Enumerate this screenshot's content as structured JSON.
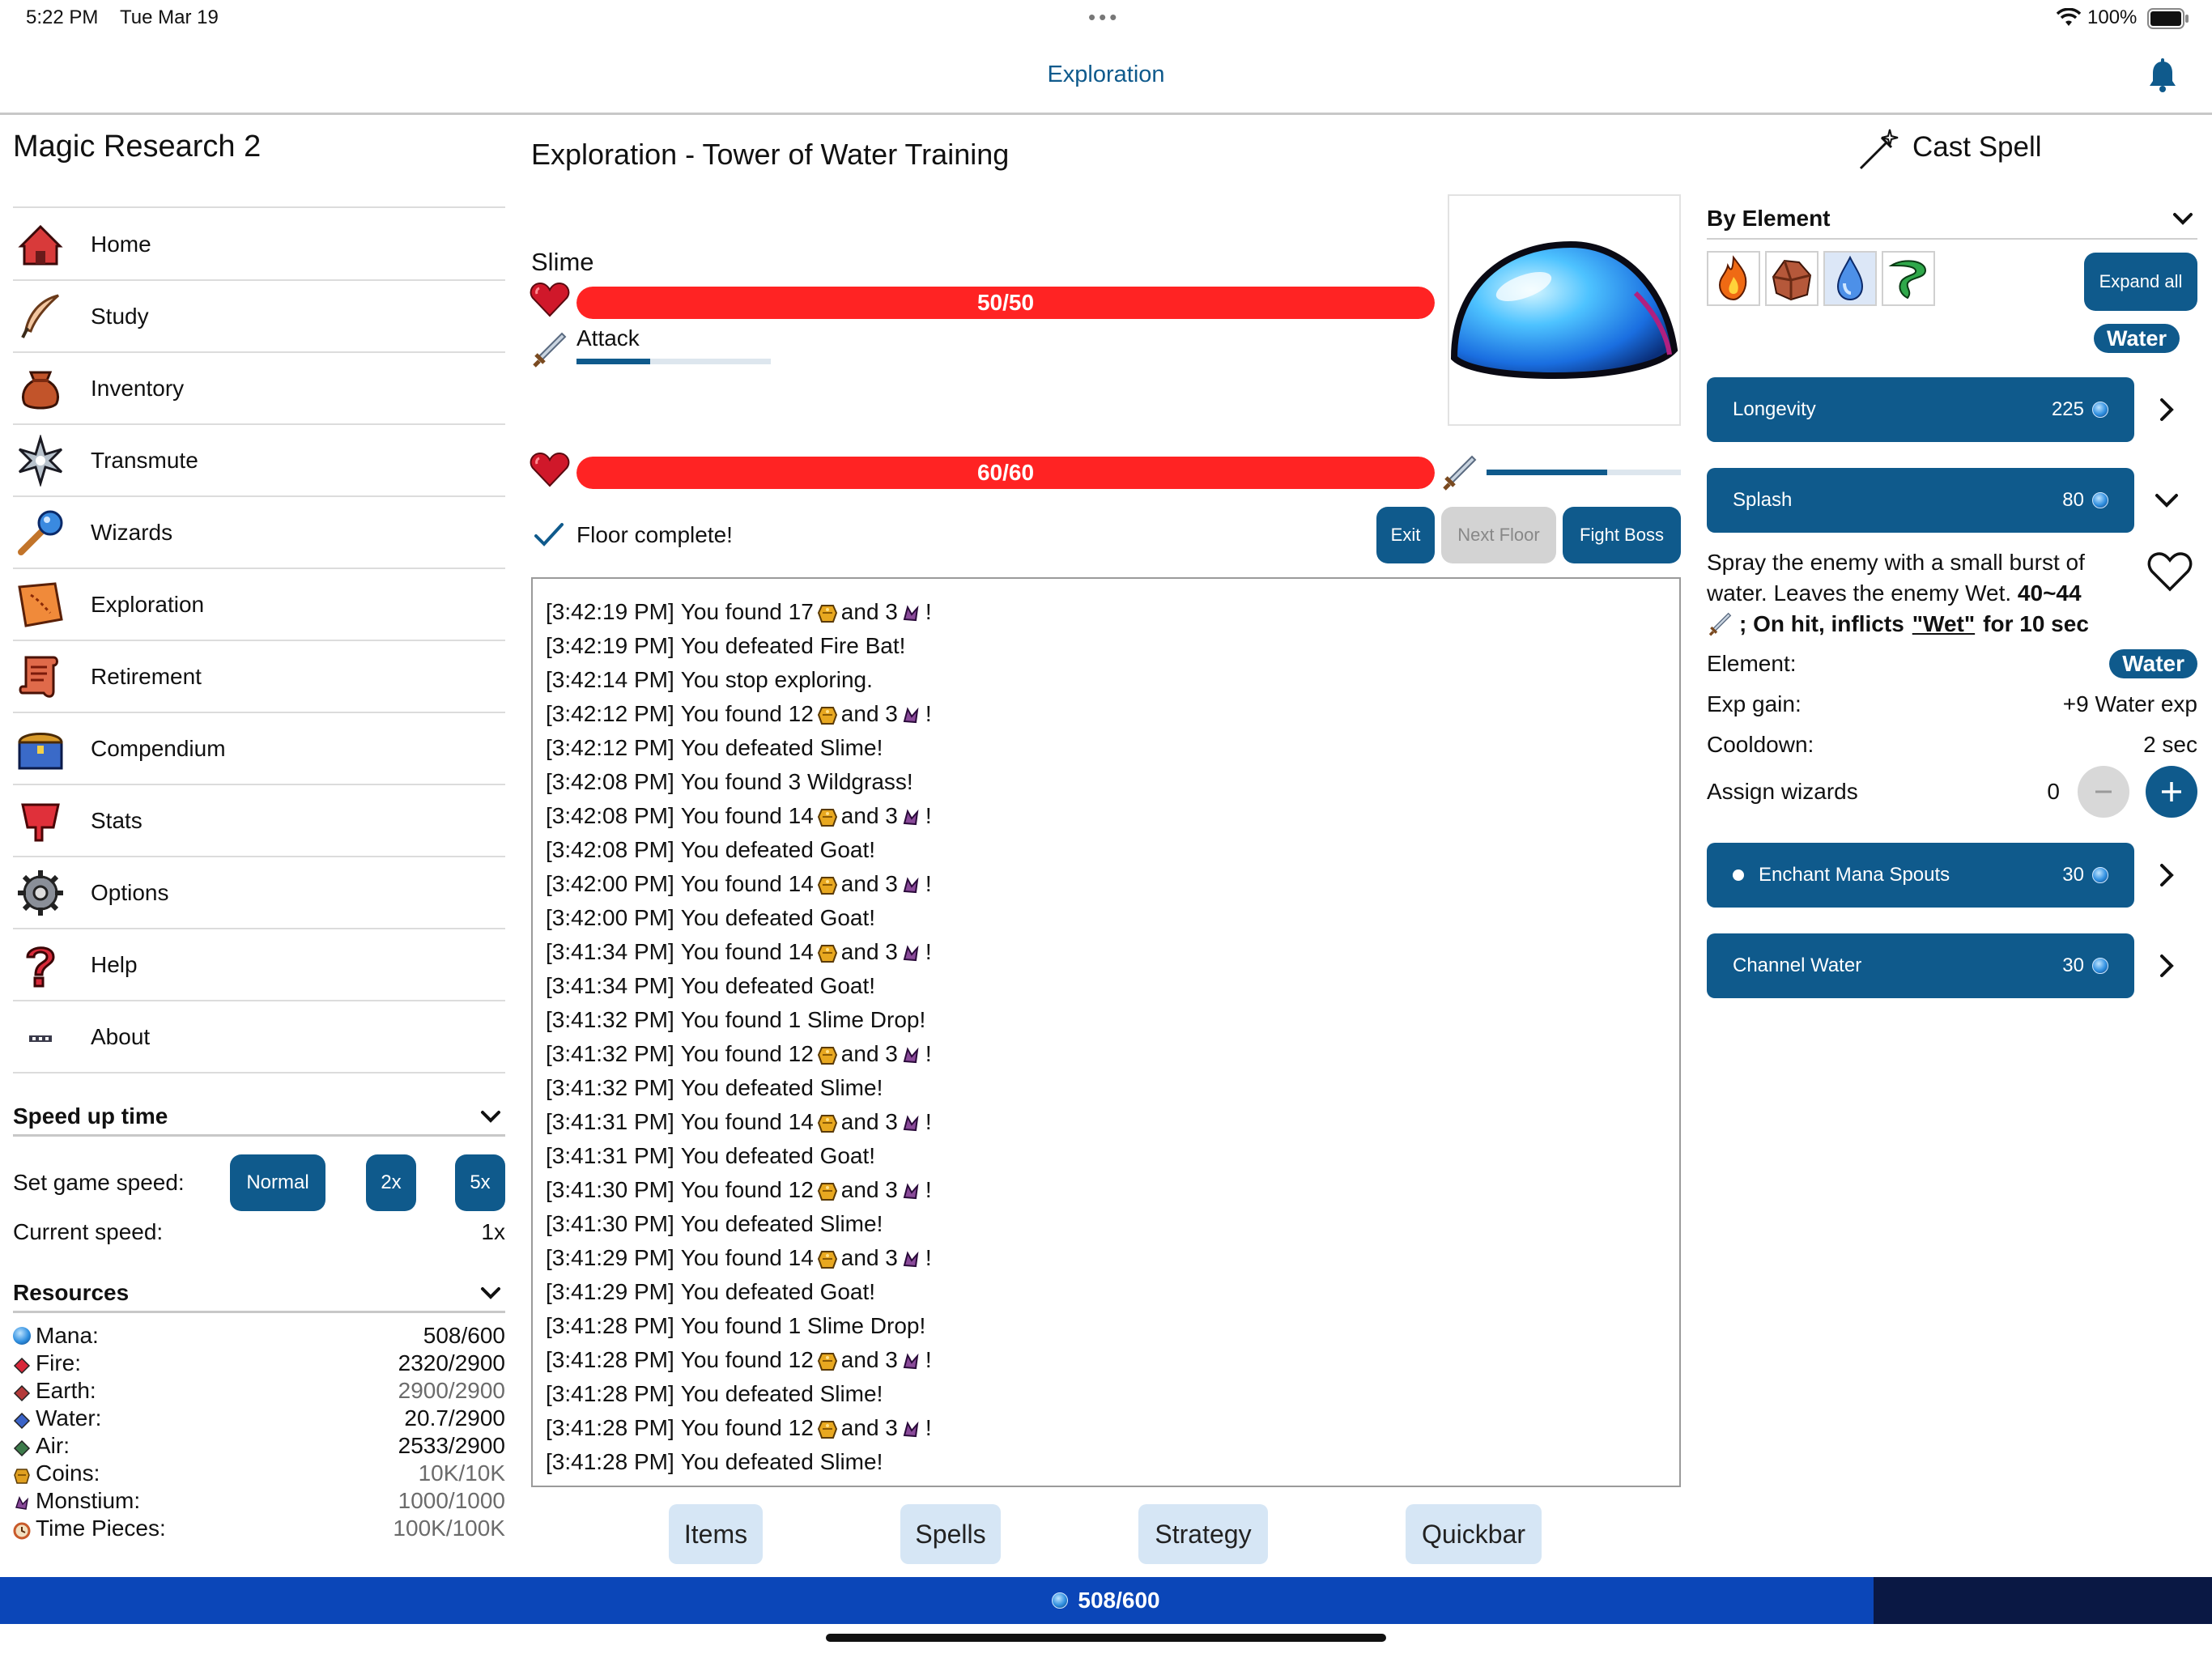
{
  "status_bar": {
    "time": "5:22 PM",
    "date": "Tue Mar 19",
    "battery": "100%"
  },
  "nav": {
    "title": "Exploration"
  },
  "sidebar": {
    "app_title": "Magic Research 2",
    "items": [
      {
        "label": "Home",
        "icon": "home-icon"
      },
      {
        "label": "Study",
        "icon": "quill-icon"
      },
      {
        "label": "Inventory",
        "icon": "bag-icon"
      },
      {
        "label": "Transmute",
        "icon": "spark-icon"
      },
      {
        "label": "Wizards",
        "icon": "wand-icon"
      },
      {
        "label": "Exploration",
        "icon": "map-icon"
      },
      {
        "label": "Retirement",
        "icon": "scroll-icon"
      },
      {
        "label": "Compendium",
        "icon": "chest-icon"
      },
      {
        "label": "Stats",
        "icon": "stats-icon"
      },
      {
        "label": "Options",
        "icon": "gear-icon"
      },
      {
        "label": "Help",
        "icon": "question-icon"
      },
      {
        "label": "About",
        "icon": "ellipsis-icon"
      }
    ],
    "speed": {
      "header": "Speed up time",
      "set_label": "Set game speed:",
      "buttons": [
        "Normal",
        "2x",
        "5x"
      ],
      "current_label": "Current speed:",
      "current_value": "1x"
    },
    "resources": {
      "header": "Resources",
      "items": [
        {
          "name": "Mana:",
          "value": "508/600",
          "full": false,
          "color": "#1e7be0"
        },
        {
          "name": "Fire:",
          "value": "2320/2900",
          "full": false,
          "color": "#d8283a"
        },
        {
          "name": "Earth:",
          "value": "2900/2900",
          "full": true,
          "color": "#b33a3a"
        },
        {
          "name": "Water:",
          "value": "20.7/2900",
          "full": false,
          "color": "#3a63c7"
        },
        {
          "name": "Air:",
          "value": "2533/2900",
          "full": false,
          "color": "#3c7a4a"
        },
        {
          "name": "Coins:",
          "value": "10K/10K",
          "full": true,
          "color": "#e0a020"
        },
        {
          "name": "Monstium:",
          "value": "1000/1000",
          "full": true,
          "color": "#7a3c8a"
        },
        {
          "name": "Time Pieces:",
          "value": "100K/100K",
          "full": true,
          "color": "#c85a2a"
        }
      ]
    }
  },
  "exploration": {
    "title": "Exploration - Tower of Water Training",
    "enemy_name": "Slime",
    "enemy_hp": "50/50",
    "enemy_hp_fraction": 1.0,
    "enemy_attack_label": "Attack",
    "enemy_attack_progress": 0.38,
    "player_hp": "60/60",
    "player_hp_fraction": 1.0,
    "player_attack_progress": 0.62,
    "floor_status": "Floor complete!",
    "buttons": {
      "exit": "Exit",
      "next_floor": "Next Floor",
      "fight_boss": "Fight Boss"
    },
    "log": [
      {
        "time": "[3:42:19 PM]",
        "text": "You found 17",
        "loot": true
      },
      {
        "time": "[3:42:19 PM]",
        "text": "You defeated Fire Bat!",
        "loot": false
      },
      {
        "time": "[3:42:14 PM]",
        "text": "You stop exploring.",
        "loot": false
      },
      {
        "time": "[3:42:12 PM]",
        "text": "You found 12",
        "loot": true
      },
      {
        "time": "[3:42:12 PM]",
        "text": "You defeated Slime!",
        "loot": false
      },
      {
        "time": "[3:42:08 PM]",
        "text": "You found 3 Wildgrass!",
        "loot": false
      },
      {
        "time": "[3:42:08 PM]",
        "text": "You found 14",
        "loot": true
      },
      {
        "time": "[3:42:08 PM]",
        "text": "You defeated Goat!",
        "loot": false
      },
      {
        "time": "[3:42:00 PM]",
        "text": "You found 14",
        "loot": true
      },
      {
        "time": "[3:42:00 PM]",
        "text": "You defeated Goat!",
        "loot": false
      },
      {
        "time": "[3:41:34 PM]",
        "text": "You found 14",
        "loot": true
      },
      {
        "time": "[3:41:34 PM]",
        "text": "You defeated Goat!",
        "loot": false
      },
      {
        "time": "[3:41:32 PM]",
        "text": "You found 1 Slime Drop!",
        "loot": false
      },
      {
        "time": "[3:41:32 PM]",
        "text": "You found 12",
        "loot": true
      },
      {
        "time": "[3:41:32 PM]",
        "text": "You defeated Slime!",
        "loot": false
      },
      {
        "time": "[3:41:31 PM]",
        "text": "You found 14",
        "loot": true
      },
      {
        "time": "[3:41:31 PM]",
        "text": "You defeated Goat!",
        "loot": false
      },
      {
        "time": "[3:41:30 PM]",
        "text": "You found 12",
        "loot": true
      },
      {
        "time": "[3:41:30 PM]",
        "text": "You defeated Slime!",
        "loot": false
      },
      {
        "time": "[3:41:29 PM]",
        "text": "You found 14",
        "loot": true
      },
      {
        "time": "[3:41:29 PM]",
        "text": "You defeated Goat!",
        "loot": false
      },
      {
        "time": "[3:41:28 PM]",
        "text": "You found 1 Slime Drop!",
        "loot": false
      },
      {
        "time": "[3:41:28 PM]",
        "text": "You found 12",
        "loot": true
      },
      {
        "time": "[3:41:28 PM]",
        "text": "You defeated Slime!",
        "loot": false
      },
      {
        "time": "[3:41:28 PM]",
        "text": "You found 12",
        "loot": true
      },
      {
        "time": "[3:41:28 PM]",
        "text": "You defeated Slime!",
        "loot": false
      }
    ],
    "loot_and": "and 3",
    "loot_end": "!",
    "tabs": [
      "Items",
      "Spells",
      "Strategy",
      "Quickbar"
    ]
  },
  "spells": {
    "header": "Cast Spell",
    "filter": "By Element",
    "elements": [
      "fire-element-icon",
      "earth-element-icon",
      "water-element-icon",
      "air-element-icon"
    ],
    "expand_all": "Expand all",
    "active_element": "Water",
    "list": [
      {
        "name": "Longevity",
        "cost": "225"
      },
      {
        "name": "Splash",
        "cost": "80"
      },
      {
        "name": "Enchant Mana Spouts",
        "cost": "30"
      },
      {
        "name": "Channel Water",
        "cost": "30"
      }
    ],
    "splash_detail": {
      "desc_1": "Spray the enemy with a small burst of",
      "desc_2a": "water. Leaves the enemy Wet.",
      "desc_2b": "40~44",
      "desc_3a": "; On hit, inflicts",
      "desc_3b": "\"Wet\"",
      "desc_3c": "for 10 sec",
      "element_label": "Element:",
      "element_value": "Water",
      "exp_label": "Exp gain:",
      "exp_value": "+9 Water exp",
      "cooldown_label": "Cooldown:",
      "cooldown_value": "2 sec",
      "assign_label": "Assign wizards",
      "assign_value": "0"
    }
  },
  "mana_bar": {
    "text": "508/600",
    "fraction": 0.847
  }
}
